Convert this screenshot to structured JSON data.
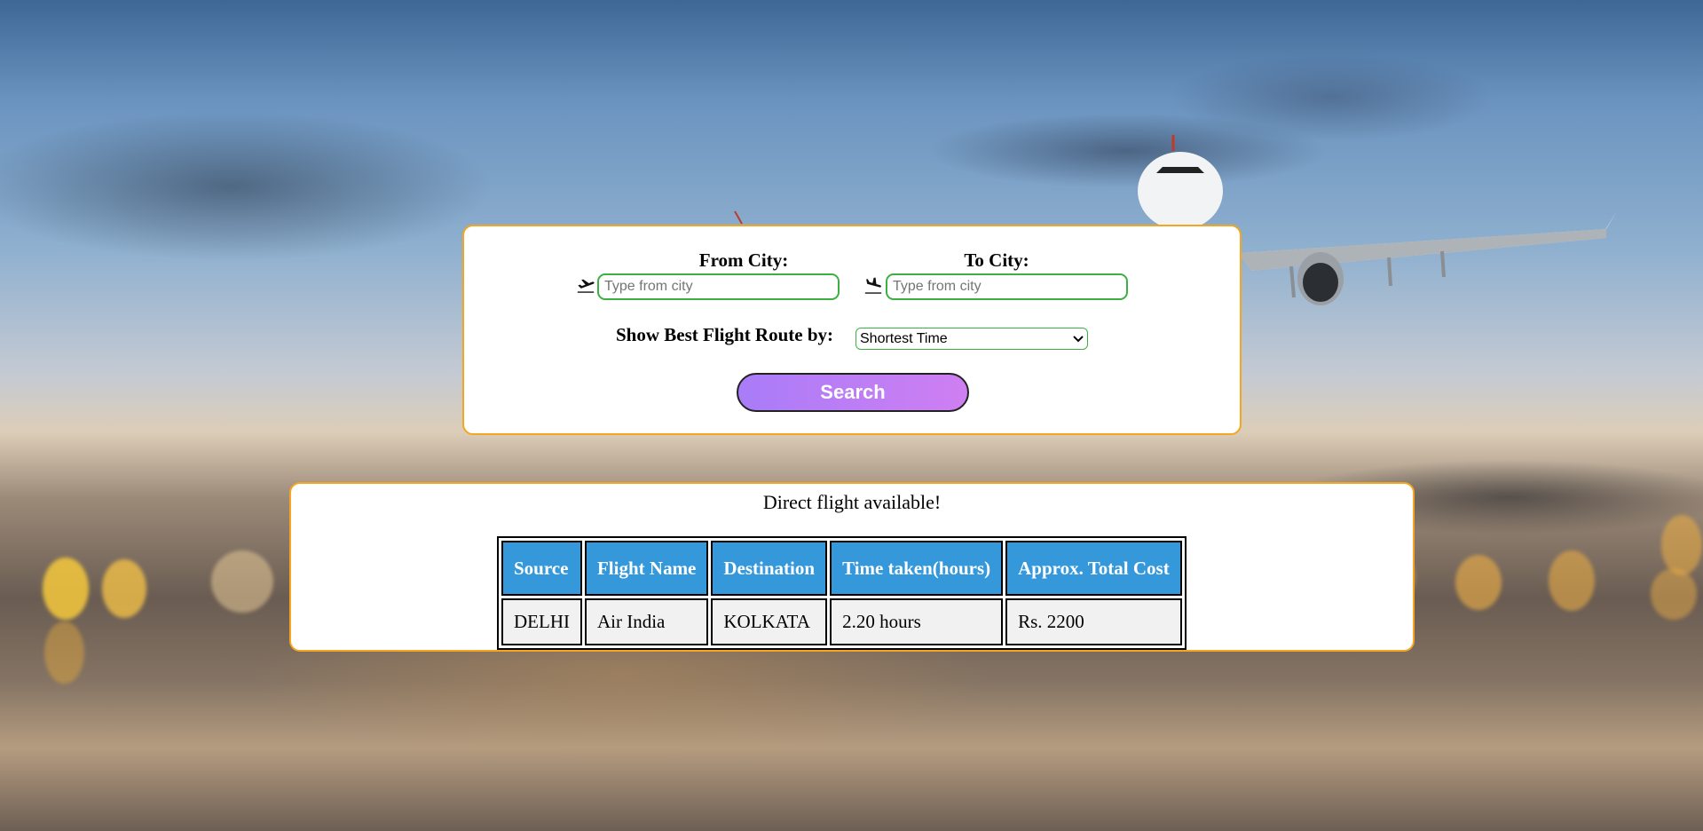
{
  "search": {
    "from_label": "From City:",
    "from_placeholder": "Type from city",
    "to_label": "To City:",
    "to_placeholder": "Type from city",
    "route_label": "Show Best Flight Route by:",
    "route_selected": "Shortest Time",
    "search_label": "Search"
  },
  "result": {
    "status": "Direct flight available!",
    "columns": [
      "Source",
      "Flight Name",
      "Destination",
      "Time taken(hours)",
      "Approx. Total Cost"
    ],
    "rows": [
      [
        "DELHI",
        "Air India",
        "KOLKATA",
        "2.20 hours",
        "Rs. 2200"
      ]
    ]
  },
  "icons": {
    "from": "takeoff-plane-icon",
    "to": "landing-plane-icon",
    "select_arrow": "chevron-down-icon"
  },
  "colors": {
    "card_border": "#f4a522",
    "input_border": "#3cb043",
    "table_header": "#3498db",
    "button_gradient_start": "#a97cf8",
    "button_gradient_end": "#cf7ff2"
  }
}
